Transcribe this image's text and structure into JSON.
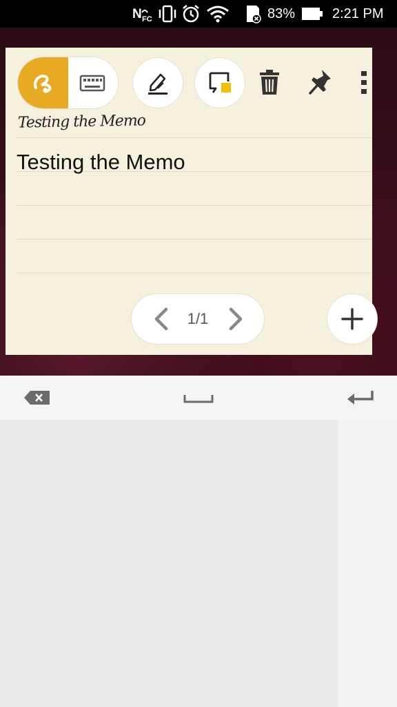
{
  "status_bar": {
    "battery_percent": "83%",
    "time": "2:21 PM",
    "icons": [
      "nfc-icon",
      "vibrate-icon",
      "alarm-icon",
      "wifi-icon",
      "sd-card-icon",
      "battery-icon"
    ]
  },
  "memo": {
    "handwritten_text": "Testing the Memo",
    "typed_text": "Testing the Memo",
    "page_indicator": "1/1",
    "accent_color": "#e8a923",
    "background_color": "#f5f1dc"
  },
  "toolbar": {
    "icons": [
      "handwriting-mode-icon",
      "keyboard-mode-icon",
      "pen-style-icon",
      "note-color-icon",
      "delete-icon",
      "pin-icon",
      "more-options-icon"
    ]
  },
  "keyboard": {
    "icons": [
      "backspace-icon",
      "space-icon",
      "enter-icon"
    ]
  }
}
